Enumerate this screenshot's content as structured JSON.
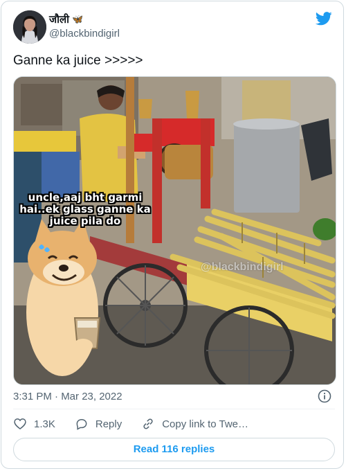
{
  "author": {
    "display_name": "जौली",
    "display_emoji": "🦋",
    "handle": "@blackbindigirl"
  },
  "tweet": {
    "text": "Ganne ka juice >>>>>",
    "timestamp": "3:31 PM · Mar 23, 2022"
  },
  "media": {
    "meme_caption": "uncle,aaj bht garmi hai..ek glass ganne ka juice pila do",
    "watermark": "@blackbindigirl"
  },
  "actions": {
    "likes_count": "1.3K",
    "reply_label": "Reply",
    "copy_link_label": "Copy link to Twe…"
  },
  "footer": {
    "read_replies_label": "Read 116 replies"
  },
  "colors": {
    "accent": "#1d9bf0",
    "secondary_text": "#536471",
    "border": "#cfd9de"
  },
  "icons": [
    "twitter-logo-icon",
    "info-icon",
    "heart-icon",
    "reply-icon",
    "link-icon"
  ]
}
